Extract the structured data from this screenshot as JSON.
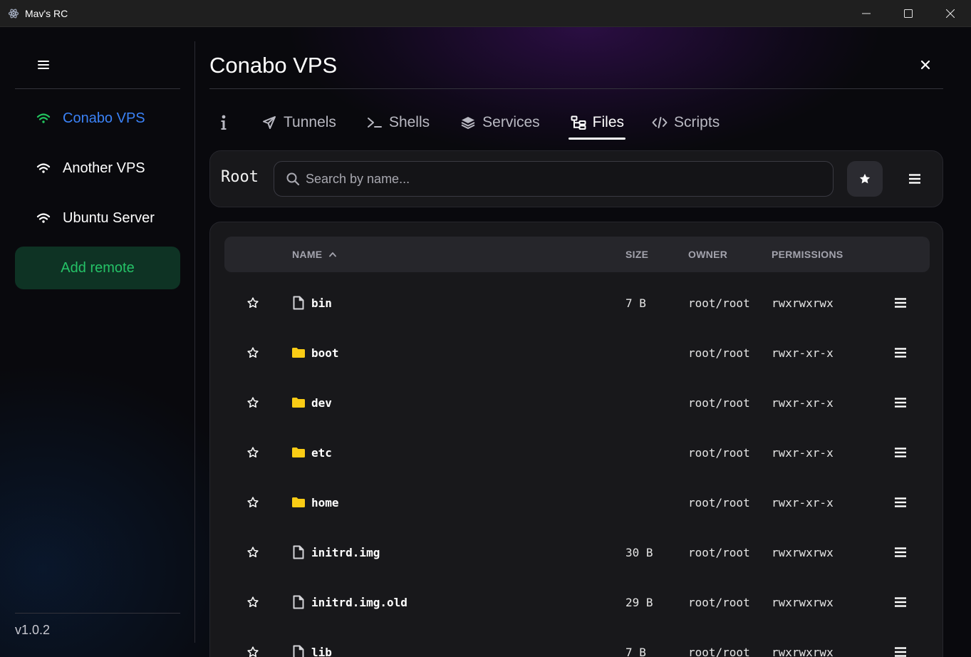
{
  "window": {
    "title": "Mav's RC"
  },
  "sidebar": {
    "remotes": [
      {
        "label": "Conabo VPS",
        "active": true
      },
      {
        "label": "Another VPS",
        "active": false
      },
      {
        "label": "Ubuntu Server",
        "active": false
      }
    ],
    "add_remote_label": "Add remote",
    "version": "v1.0.2"
  },
  "main": {
    "title": "Conabo VPS",
    "tabs": [
      {
        "label": "",
        "icon": "info-icon"
      },
      {
        "label": "Tunnels",
        "icon": "send-icon"
      },
      {
        "label": "Shells",
        "icon": "terminal-icon"
      },
      {
        "label": "Services",
        "icon": "layers-icon"
      },
      {
        "label": "Files",
        "icon": "folder-tree-icon",
        "active": true
      },
      {
        "label": "Scripts",
        "icon": "code-icon"
      }
    ],
    "toolbar": {
      "breadcrumb": "Root",
      "search_placeholder": "Search by name...",
      "search_value": ""
    },
    "table": {
      "columns": {
        "name": "NAME",
        "size": "SIZE",
        "owner": "OWNER",
        "permissions": "PERMISSIONS"
      },
      "rows": [
        {
          "name": "bin",
          "type": "file",
          "size": "7 B",
          "owner": "root/root",
          "permissions": "rwxrwxrwx"
        },
        {
          "name": "boot",
          "type": "folder",
          "size": "",
          "owner": "root/root",
          "permissions": "rwxr-xr-x"
        },
        {
          "name": "dev",
          "type": "folder",
          "size": "",
          "owner": "root/root",
          "permissions": "rwxr-xr-x"
        },
        {
          "name": "etc",
          "type": "folder",
          "size": "",
          "owner": "root/root",
          "permissions": "rwxr-xr-x"
        },
        {
          "name": "home",
          "type": "folder",
          "size": "",
          "owner": "root/root",
          "permissions": "rwxr-xr-x"
        },
        {
          "name": "initrd.img",
          "type": "file",
          "size": "30 B",
          "owner": "root/root",
          "permissions": "rwxrwxrwx"
        },
        {
          "name": "initrd.img.old",
          "type": "file",
          "size": "29 B",
          "owner": "root/root",
          "permissions": "rwxrwxrwx"
        },
        {
          "name": "lib",
          "type": "file",
          "size": "7 B",
          "owner": "root/root",
          "permissions": "rwxrwxrwx"
        }
      ]
    }
  },
  "colors": {
    "active_remote": "#3b82f6",
    "wifi_active": "#22c55e",
    "add_remote_text": "#25c267",
    "folder": "#facc15"
  }
}
